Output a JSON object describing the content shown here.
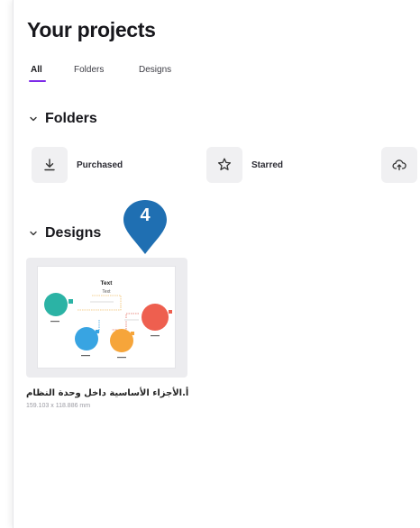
{
  "header": {
    "title": "Your projects"
  },
  "tabs": [
    {
      "label": "All",
      "active": true
    },
    {
      "label": "Folders",
      "active": false
    },
    {
      "label": "Designs",
      "active": false
    }
  ],
  "folders_section": {
    "title": "Folders",
    "items": [
      {
        "label": "Purchased",
        "icon": "download-icon"
      },
      {
        "label": "Starred",
        "icon": "star-icon"
      },
      {
        "label": "",
        "icon": "cloud-upload-icon"
      }
    ]
  },
  "designs_section": {
    "title": "Designs",
    "items": [
      {
        "title": "أ.الأجزاء الأساسية داخل وحدة النظام",
        "size": "159.103 x 118.886 mm",
        "thumbnail": {
          "heading": "Text",
          "subheading": "Text"
        }
      }
    ]
  },
  "callout": {
    "number": "4",
    "color": "#1f6fb2"
  },
  "colors": {
    "accent": "#7d2ae8"
  }
}
